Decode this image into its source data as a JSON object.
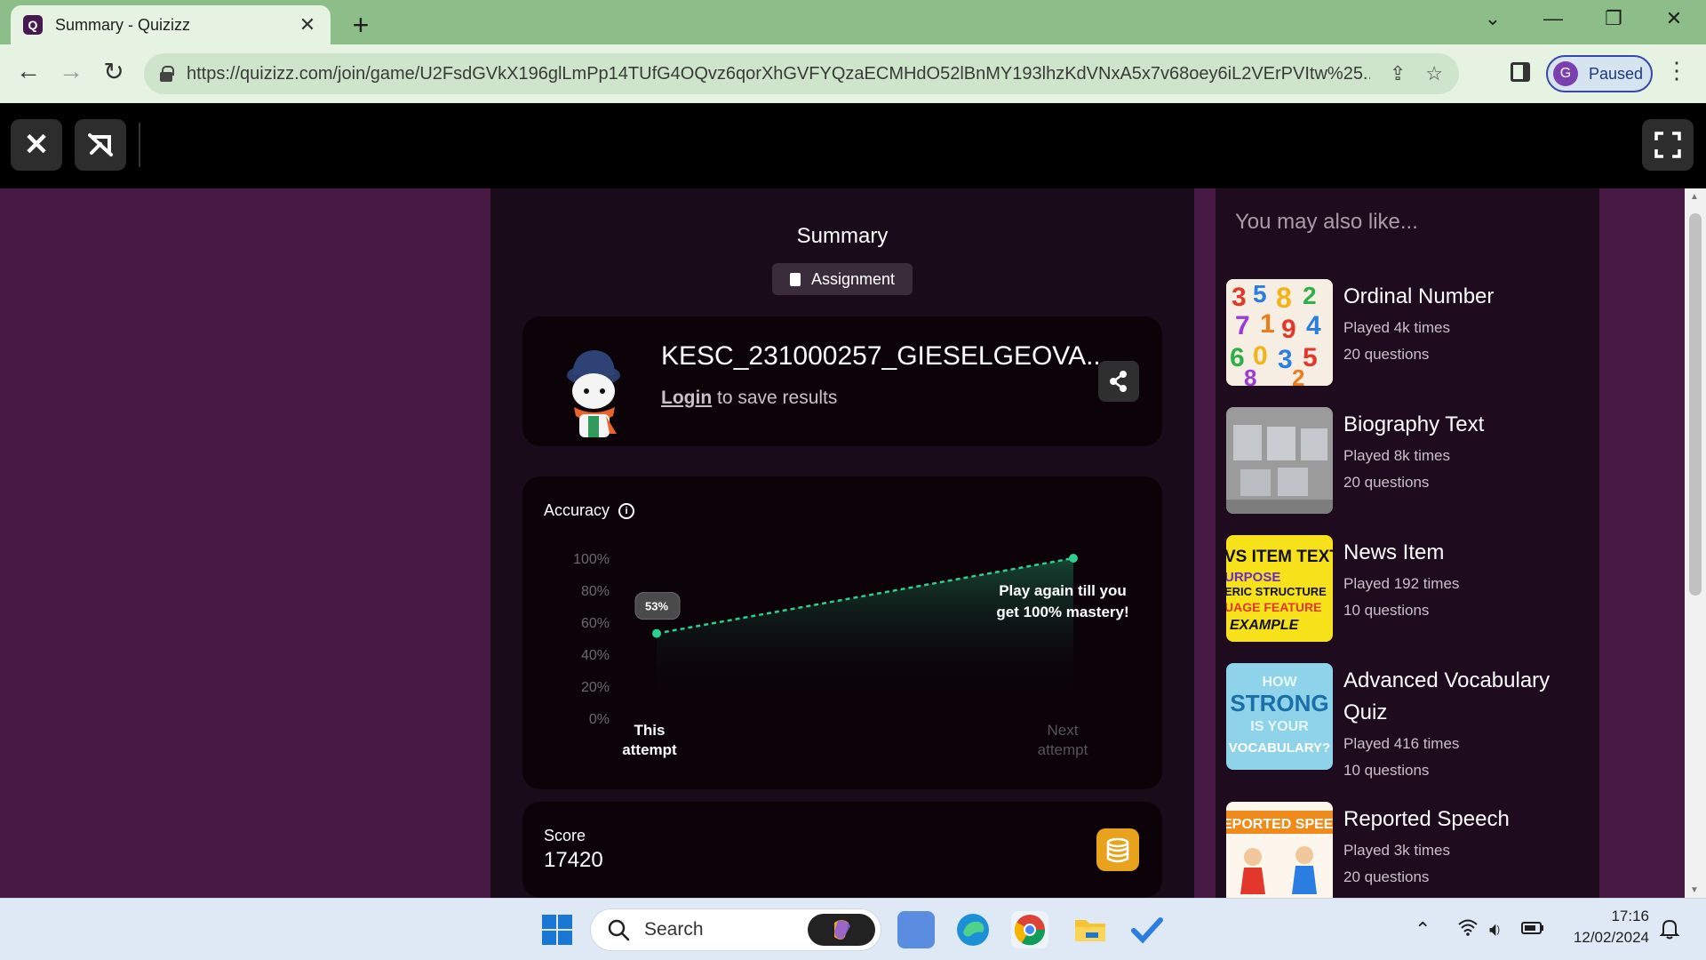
{
  "browser": {
    "tab_title": "Summary - Quizizz",
    "tab_favicon_letter": "Q",
    "tab_close": "✕",
    "new_tab": "+",
    "url": "https://quizizz.com/join/game/U2FsdGVkX196glLmPp14TUfG4OQvz6qorXhGVFYQzaECMHdO52lBnMY193lhzKdVNxA5x7v68oey6iL2VErPVItw%25...",
    "profile_initial": "G",
    "profile_status": "Paused"
  },
  "summary": {
    "title": "Summary",
    "mode_badge": "Assignment"
  },
  "player": {
    "name": "KESC_231000257_GIESELGEOVA...",
    "login_link": "Login",
    "login_suffix": " to save results"
  },
  "accuracy": {
    "label": "Accuracy",
    "info_glyph": "i",
    "this_attempt_value": 53,
    "this_attempt_label": "53%",
    "next_attempt_target": 100,
    "callout_line1": "Play again till you",
    "callout_line2": "get 100% mastery!",
    "y_ticks": [
      "100%",
      "80%",
      "60%",
      "40%",
      "20%",
      "0%"
    ],
    "x_left_line1": "This",
    "x_left_line2": "attempt",
    "x_right_line1": "Next",
    "x_right_line2": "attempt",
    "colors": {
      "line": "#2ecf8e",
      "badge": "#4a4a4a"
    }
  },
  "score": {
    "label": "Score",
    "value": "17420"
  },
  "recommendations": {
    "title": "You may also like...",
    "items": [
      {
        "title": "Ordinal Number",
        "played": "Played 4k times",
        "questions": "20 questions",
        "thumb": "numbers"
      },
      {
        "title": "Biography Text",
        "played": "Played 8k times",
        "questions": "20 questions",
        "thumb": "photo"
      },
      {
        "title": "News Item",
        "played": "Played 192 times",
        "questions": "10 questions",
        "thumb": "yellow",
        "thumb_lines": [
          "VS ITEM TEXT",
          "URPOSE",
          "ERIC STRUCTURE",
          "UAGE FEATURE",
          "EXAMPLE"
        ]
      },
      {
        "title": "Advanced Vocabulary Quiz",
        "played": "Played 416 times",
        "questions": "10 questions",
        "thumb": "blue",
        "thumb_lines": [
          "HOW",
          "STRONG",
          "IS YOUR",
          "VOCABULARY?"
        ]
      },
      {
        "title": "Reported Speech",
        "played": "Played 3k times",
        "questions": "20 questions",
        "thumb": "cartoon",
        "thumb_lines": [
          "EPORTED SPEEC"
        ]
      }
    ]
  },
  "taskbar": {
    "search_placeholder": "Search",
    "time": "17:16",
    "date": "12/02/2024"
  }
}
